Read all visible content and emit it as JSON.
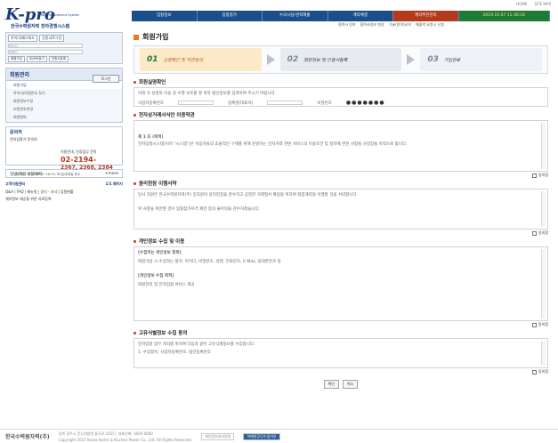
{
  "top_links": [
    "HOME",
    "SITE MAP"
  ],
  "logo": {
    "main": "K-pro",
    "sub": "KHNP Procurement System",
    "kr": "한국수력원자력 전자경쟁시스템"
  },
  "nav": [
    "입찰정보",
    "입찰참가",
    "수의시담/견적제출",
    "계약체결",
    "계약추진관리",
    "2019.10.07 11:36:16"
  ],
  "subnav": [
    "협력사 정보",
    "협력사정보 변경",
    "기술(용역)요약",
    "매출액 요청시 신청"
  ],
  "login": {
    "tabs": [
      "아이디/패스워드",
      "인증서로그인"
    ],
    "id": "아이디",
    "pw": "인증서",
    "button": "로그인",
    "links": [
      "회원가입",
      "ID/PW찾기",
      "인증서등록"
    ]
  },
  "menu": {
    "title": "회원관리",
    "items": [
      "회원가입",
      "아이디/비밀번호 찾기",
      "회원정보수정",
      "비밀번호변경",
      "회원탈퇴"
    ]
  },
  "support": {
    "title": "문의처",
    "label": "전자입찰가 문의처",
    "line": "이용안내, 인증업무 문의",
    "phone1": "02-2194-",
    "phone2": "2367, 2368, 2384",
    "hours": "상담시간: 평일 09:00~18:00, 토/일/공휴일 휴무"
  },
  "faq": {
    "label": "일반/계약 이해계획",
    "more": "+more"
  },
  "notice": {
    "title": "고객지원센터",
    "page": "1/1 페이지",
    "lines": [
      "Q&A | FAQ | 매뉴얼 | 양식 · 서식 | 입찰현황",
      "계약정보 제공을 위한 자료등록"
    ]
  },
  "page_title": "회원가입",
  "steps": [
    {
      "num": "01",
      "label": "실명확인 및 약관동의"
    },
    {
      "num": "02",
      "label": "회원정보 및 인증서등록"
    },
    {
      "num": "03",
      "label": "가입완료"
    }
  ],
  "sections": {
    "realname": {
      "title": "회원실명확인",
      "desc": "아래 각 실명의 이용 중 수행 보조를 할 위하 법인정보를 입력하여 주시기 바랍니다.",
      "fields": [
        "사업자등록번호",
        "업체명(대표자)",
        "비밀번호"
      ],
      "pw_dots": "●●●●●●●"
    },
    "terms": {
      "title": "전자상거래서식안 이용약관",
      "body": [
        "제 1 조 (목적)",
        "전자입찰시스템(이하 \"시스템\")은 이용자들의 효율적인 구매를 위해 운영하는 전자거래 관련 서비스의 이용조건 및 절차에 관한 사항을 규정함을 목적으로 합니다."
      ],
      "agree": "동의함"
    },
    "ethic": {
      "title": "윤리헌장 이행서약",
      "body": [
        "당사 직원은 한국수력원자력(주) 임직원의 윤리헌장을 준수하고 공정한 거래질서 확립을 위하여 청렴계약을 이행할 것을 서약합니다.",
        "위 사항을 위반할 경우 입찰참가자격 제한 등의 불이익을 감수하겠습니다."
      ],
      "agree": "동의함"
    },
    "privacy": {
      "title": "개인정보 수집 및 이용",
      "body": [
        "[수집하는 개인정보 항목]",
        "회원가입 시 수집하는 항목: 아이디, 비밀번호, 성명, 전화번호, E-Mail, 휴대폰번호 등",
        "[개인정보 수집 목적]",
        "회원관리 및 전자입찰 서비스 제공"
      ],
      "agree": "동의함"
    },
    "third": {
      "title": "고유식별정보 수집 동의",
      "body": [
        "전자입찰 업무 처리를 위하여 다음과 같이 고유식별정보를 수집합니다.",
        "1. 수집항목: 사업자등록번호, 법인등록번호"
      ],
      "agree": "동의함"
    }
  },
  "buttons": [
    "확인",
    "취소"
  ],
  "footer": {
    "company": "한국수력원자력(주)",
    "addr": "경북 경주시 문무대왕면 불국로 1655 | 대표전화: 1600-4000",
    "copy": "Copyright 2017 Korea Hydro & Nuclear Power Co., Ltd. All Rights Reserved.",
    "links": [
      "개인정보처리방침",
      "이메일무단수집거부"
    ]
  }
}
